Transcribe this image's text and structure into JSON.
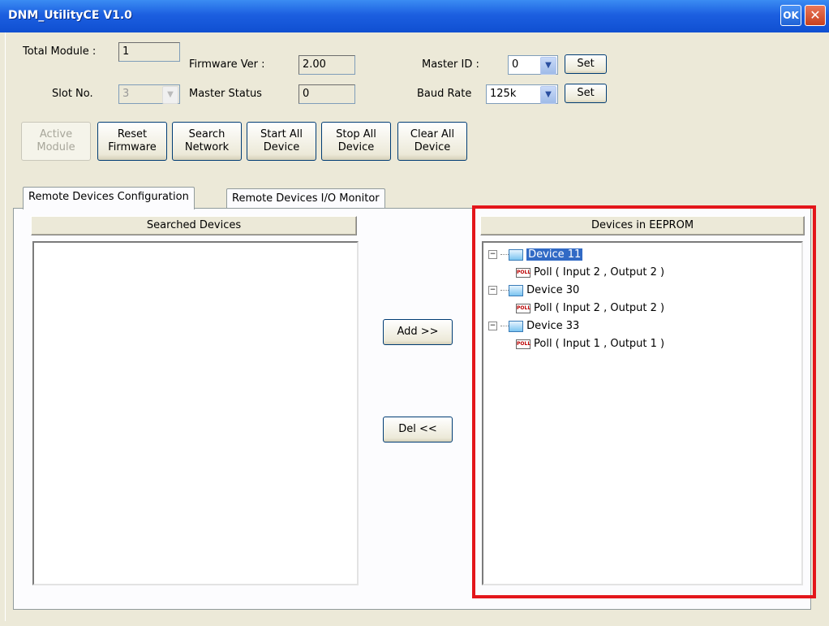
{
  "window": {
    "title": "DNM_UtilityCE V1.0",
    "ok_label": "OK",
    "close_label": "✕"
  },
  "fields": {
    "total_module_label": "Total Module :",
    "total_module_value": "1",
    "slot_no_label": "Slot No.",
    "slot_no_value": "3",
    "firmware_ver_label": "Firmware Ver :",
    "firmware_ver_value": "2.00",
    "master_status_label": "Master Status",
    "master_status_value": "0",
    "master_id_label": "Master ID :",
    "master_id_value": "0",
    "baud_rate_label": "Baud Rate",
    "baud_rate_value": "125k",
    "set_label": "Set"
  },
  "toolbar": {
    "active_module": [
      "Active",
      "Module"
    ],
    "reset_firmware": [
      "Reset",
      "Firmware"
    ],
    "search_network": [
      "Search",
      "Network"
    ],
    "start_all_device": [
      "Start All",
      "Device"
    ],
    "stop_all_device": [
      "Stop All",
      "Device"
    ],
    "clear_all_device": [
      "Clear All",
      "Device"
    ]
  },
  "tabs": [
    {
      "label": "Remote Devices Configuration"
    },
    {
      "label": "Remote Devices I/O Monitor"
    }
  ],
  "panel": {
    "searched_header": "Searched Devices",
    "eeprom_header": "Devices in EEPROM",
    "add_label": "Add >>",
    "del_label": "Del <<"
  },
  "tree": [
    {
      "device": "Device 11",
      "child": "Poll ( Input 2 , Output 2 )"
    },
    {
      "device": "Device 30",
      "child": "Poll ( Input 2 , Output 2 )"
    },
    {
      "device": "Device 33",
      "child": "Poll ( Input 1 , Output 1 )"
    }
  ],
  "icons": {
    "poll": "POLL",
    "expander": "−"
  },
  "colors": {
    "accent": "#e3161b",
    "titlebar": "#1c5fe0",
    "selection": "#316ac5"
  }
}
